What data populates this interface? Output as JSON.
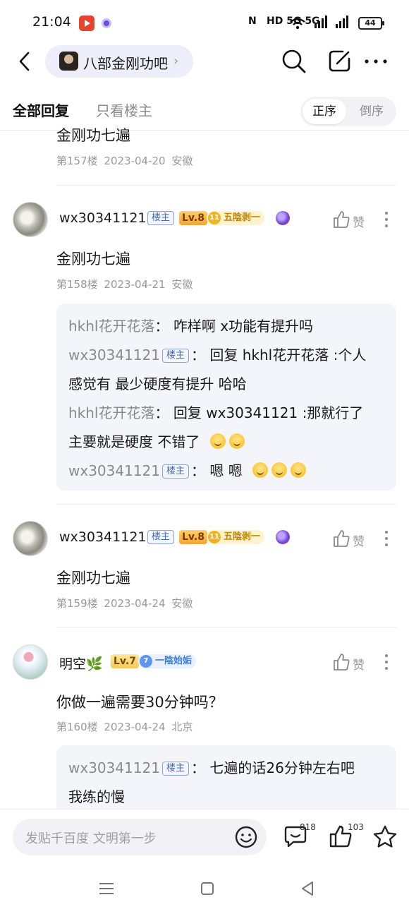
{
  "status_bar": {
    "time": "21:04",
    "battery": "44",
    "network": "HD 5G 5G"
  },
  "header": {
    "forum_name": "八部金刚功吧"
  },
  "tabs": {
    "all_replies": "全部回复",
    "op_only": "只看楼主"
  },
  "sort": {
    "ascending": "正序",
    "descending": "倒序"
  },
  "top_fragment": {
    "text": "金刚功七遍",
    "floor": "第157楼",
    "date": "2023-04-20",
    "location": "安徽"
  },
  "posts": [
    {
      "username": "wx30341121",
      "badge": "楼主",
      "level": "Lv.8",
      "title_num": "11",
      "title": "五陰剥一",
      "like_label": "赞",
      "content": "金刚功七遍",
      "floor": "第158楼",
      "date": "2023-04-21",
      "location": "安徽",
      "replies": [
        {
          "name": "hkhl花开花落",
          "sep": "：",
          "text": "咋样啊 x功能有提升吗"
        },
        {
          "name": "wx30341121",
          "badge": "楼主",
          "sep": "：",
          "text": "回复 hkhl花开花落 :个人",
          "cont": "感觉有 最少硬度有提升 哈哈"
        },
        {
          "name": "hkhl花开花落",
          "sep": "：",
          "text": "回复 wx30341121 :那就行了",
          "cont": "主要就是硬度 不错了"
        },
        {
          "name": "wx30341121",
          "badge": "楼主",
          "sep": "：",
          "text": "嗯 嗯"
        }
      ]
    },
    {
      "username": "wx30341121",
      "badge": "楼主",
      "level": "Lv.8",
      "title_num": "11",
      "title": "五陰剥一",
      "like_label": "赞",
      "content": "金刚功七遍",
      "floor": "第159楼",
      "date": "2023-04-24",
      "location": "安徽"
    },
    {
      "username": "明空",
      "level": "Lv.7",
      "title_num": "7",
      "title": "一陰始姤",
      "like_label": "赞",
      "content": "你做一遍需要30分钟吗？",
      "floor": "第160楼",
      "date": "2023-04-24",
      "location": "北京",
      "replies": [
        {
          "name": "wx30341121",
          "badge": "楼主",
          "sep": "：",
          "text": "七遍的话26分钟左右吧",
          "cont": "我练的慢"
        }
      ]
    }
  ],
  "bottom": {
    "placeholder": "发贴千百度 文明第一步",
    "comment_count": "818",
    "like_count": "103"
  },
  "icons": [
    "back-icon",
    "search-icon",
    "edit-icon",
    "more-icon",
    "thumb-up-icon",
    "kebab-icon",
    "emoji-icon",
    "comment-icon",
    "star-icon",
    "menu-nav-icon",
    "home-nav-icon",
    "back-nav-icon"
  ]
}
